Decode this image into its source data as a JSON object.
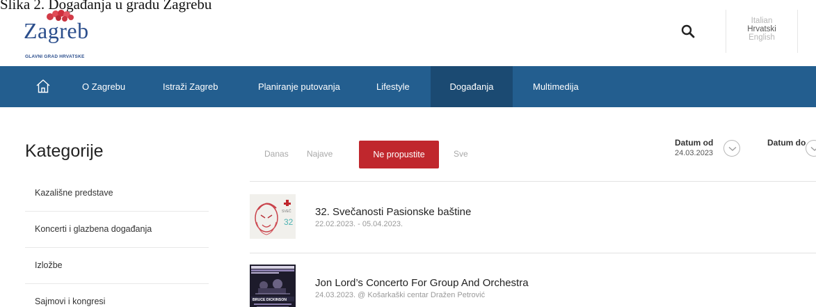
{
  "caption": "Slika 2. Događanja u gradu Zagrebu",
  "logo": {
    "word": "Zagreb",
    "tagline": "GLAVNI GRAD HRVATSKE"
  },
  "header": {
    "search_icon": "search-icon",
    "languages": [
      "Italian",
      "Hrvatski",
      "English"
    ],
    "active_language": "Hrvatski"
  },
  "nav": {
    "home_icon": "home-icon",
    "items": [
      "O Zagrebu",
      "Istraži Zagreb",
      "Planiranje putovanja",
      "Lifestyle",
      "Događanja",
      "Multimedija"
    ],
    "active": "Događanja"
  },
  "sidebar": {
    "title": "Kategorije",
    "items": [
      "Kazališne predstave",
      "Koncerti i glazbena događanja",
      "Izložbe",
      "Sajmovi i kongresi"
    ]
  },
  "filters": {
    "tabs": [
      "Danas",
      "Najave",
      "Ne propustite",
      "Sve"
    ],
    "active": "Ne propustite",
    "date_from_label": "Datum od",
    "date_from_value": "24.03.2023",
    "date_to_label": "Datum do",
    "dropdown_icon": "chevron-down-icon"
  },
  "events": [
    {
      "title": "32. Svečanosti Pasionske baštine",
      "meta": "22.02.2023. - 05.04.2023."
    },
    {
      "title": "Jon Lord’s Concerto For Group And Orchestra",
      "meta": "24.03.2023. @ Košarkaški centar Dražen Petrović",
      "thumb_caption": "BRUCE DICKINSON"
    }
  ],
  "colors": {
    "nav": "#235e8f",
    "nav_active": "#1b4a72",
    "accent": "#c0272d",
    "logo": "#2b4e8c"
  }
}
